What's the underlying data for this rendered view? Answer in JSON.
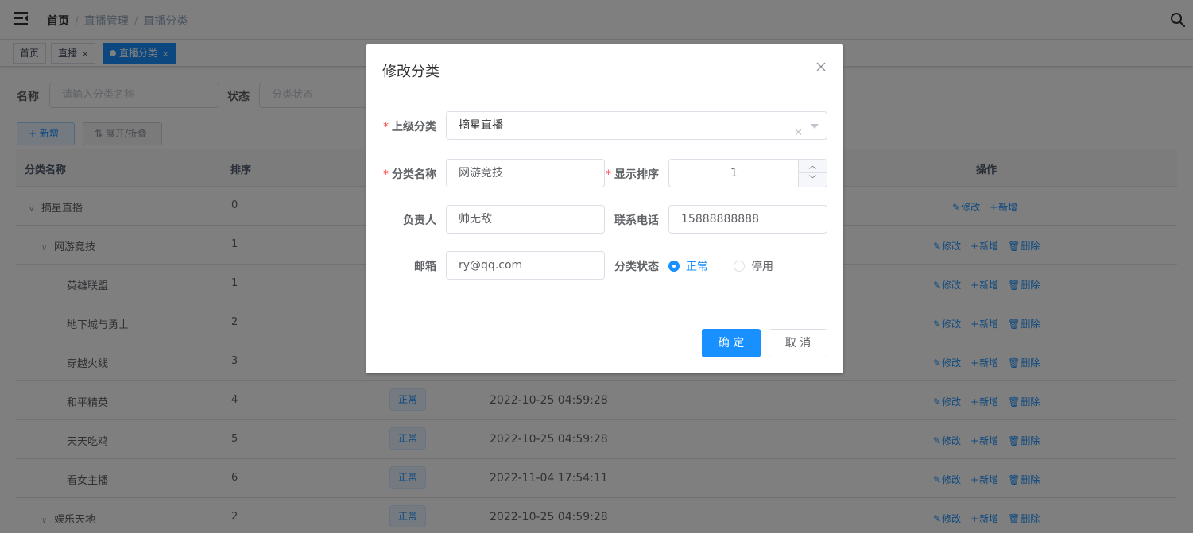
{
  "breadcrumb": [
    "首页",
    "直播管理",
    "直播分类"
  ],
  "tags": [
    {
      "label": "首页"
    },
    {
      "label": "直播",
      "close": "×"
    },
    {
      "label": "直播分类",
      "close": "×"
    }
  ],
  "search": {
    "name_label": "名称",
    "name_placeholder": "请输入分类名称",
    "status_label": "状态",
    "status_placeholder": "分类状态"
  },
  "toolbar": {
    "add_label": "+ 新增",
    "expand_label": "⇅ 展开/折叠"
  },
  "table": {
    "headers": {
      "name": "分类名称",
      "sort": "排序",
      "ops": "操作"
    },
    "rows": [
      {
        "name": "摘星直播",
        "sort": "0",
        "status": "",
        "time": "",
        "chev": "∨",
        "ops": [
          "修改",
          "新增"
        ]
      },
      {
        "name": "网游竞技",
        "sort": "1",
        "status": "",
        "time": "",
        "chev": "∨",
        "ops": [
          "修改",
          "新增",
          "删除"
        ]
      },
      {
        "name": "英雄联盟",
        "sort": "1",
        "status": "",
        "time": "",
        "chev": "",
        "ops": [
          "修改",
          "新增",
          "删除"
        ]
      },
      {
        "name": "地下城与勇士",
        "sort": "2",
        "status": "",
        "time": "",
        "chev": "",
        "ops": [
          "修改",
          "新增",
          "删除"
        ]
      },
      {
        "name": "穿越火线",
        "sort": "3",
        "status": "",
        "time": "",
        "chev": "",
        "ops": [
          "修改",
          "新增",
          "删除"
        ]
      },
      {
        "name": "和平精英",
        "sort": "4",
        "status": "正常",
        "time": "2022-10-25 04:59:28",
        "chev": "",
        "ops": [
          "修改",
          "新增",
          "删除"
        ]
      },
      {
        "name": "天天吃鸡",
        "sort": "5",
        "status": "正常",
        "time": "2022-10-25 04:59:28",
        "chev": "",
        "ops": [
          "修改",
          "新增",
          "删除"
        ]
      },
      {
        "name": "看女主播",
        "sort": "6",
        "status": "正常",
        "time": "2022-11-04 17:54:11",
        "chev": "",
        "ops": [
          "修改",
          "新增",
          "删除"
        ]
      },
      {
        "name": "娱乐天地",
        "sort": "2",
        "status": "正常",
        "time": "2022-10-25 04:59:28",
        "chev": "∨",
        "ops": [
          "修改",
          "新增",
          "删除"
        ]
      }
    ]
  },
  "dialog": {
    "title": "修改分类",
    "parent_label": "上级分类",
    "parent_value": "摘星直播",
    "name_label": "分类名称",
    "name_value": "网游竞技",
    "order_label": "显示排序",
    "order_value": "1",
    "leader_label": "负责人",
    "leader_value": "帅无敌",
    "phone_label": "联系电话",
    "phone_value": "15888888888",
    "email_label": "邮箱",
    "email_value": "ry@qq.com",
    "status_label": "分类状态",
    "status_options": [
      "正常",
      "停用"
    ],
    "status_selected": "正常",
    "required_mark": "*",
    "confirm_label": "确 定",
    "cancel_label": "取 消"
  },
  "colors": {
    "primary": "#1890ff",
    "required": "#ff4949"
  }
}
